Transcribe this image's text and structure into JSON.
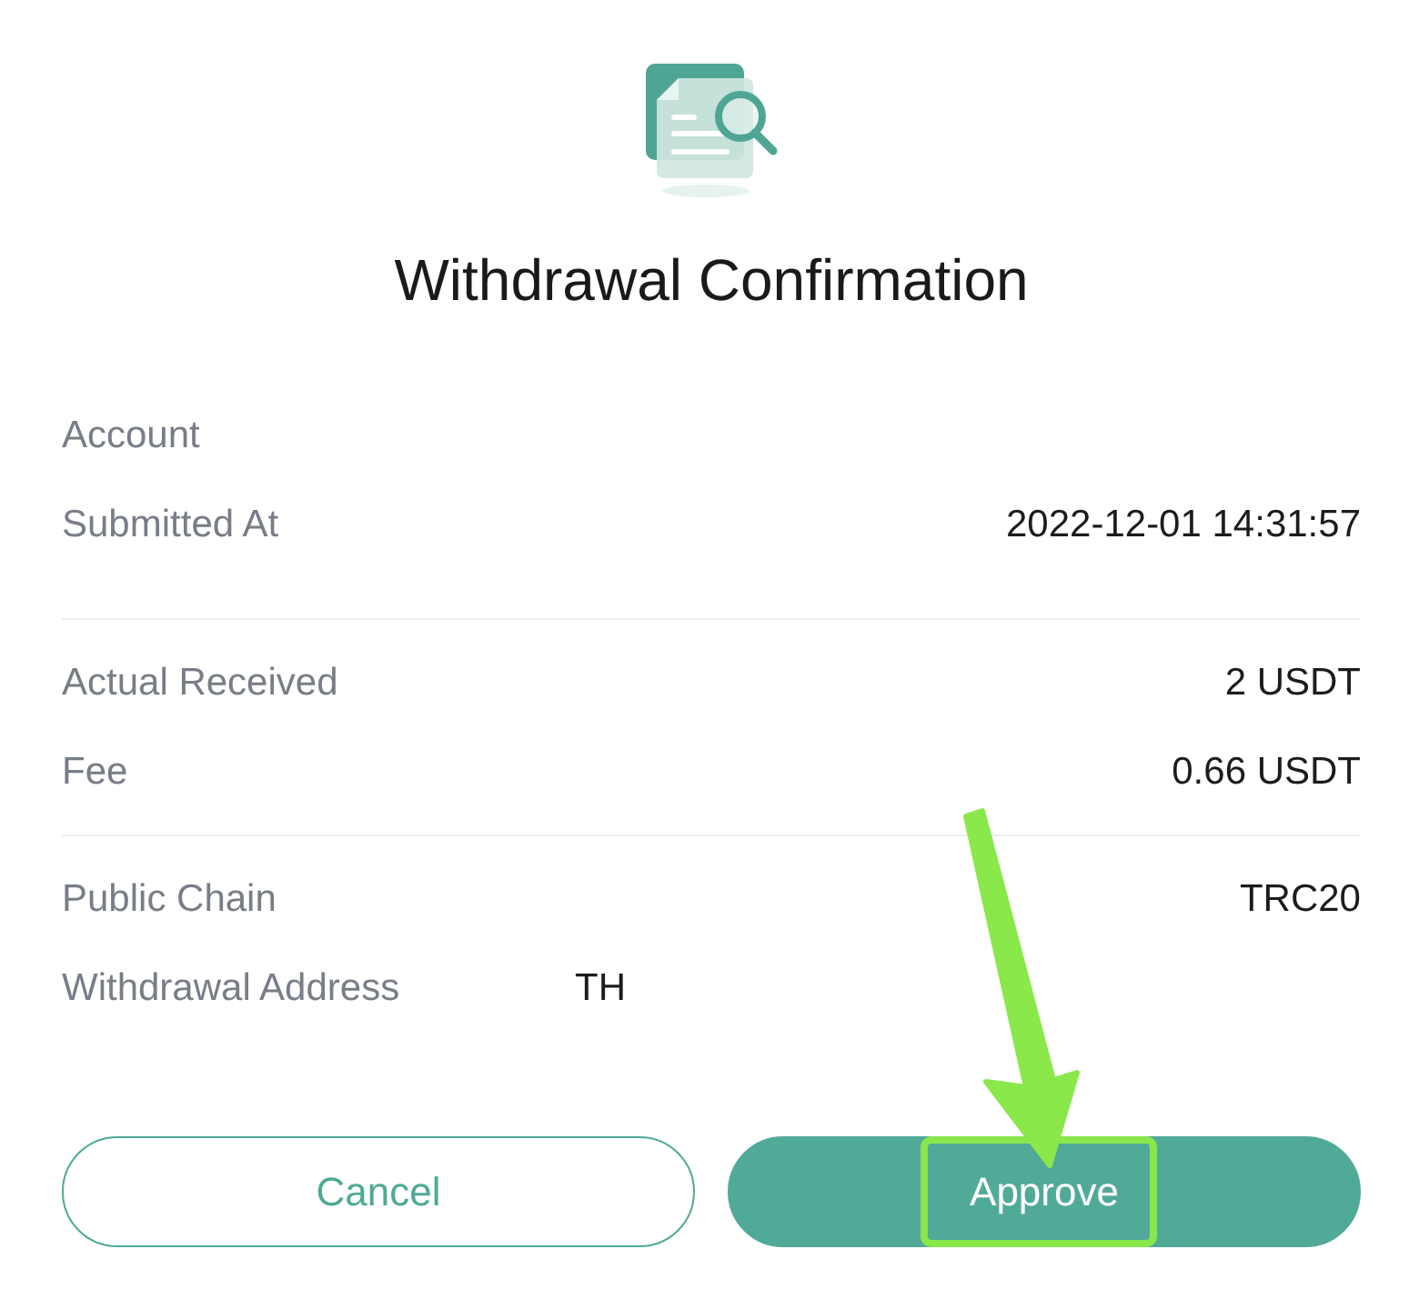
{
  "dialog": {
    "title": "Withdrawal Confirmation",
    "sections": [
      {
        "rows": [
          {
            "kind": "text",
            "label": "Account"
          },
          {
            "kind": "text",
            "label": "Submitted At",
            "value": "2022-12-01 14:31:57"
          }
        ]
      },
      {
        "rows": [
          {
            "kind": "text",
            "label": "Actual Received",
            "value": "2 USDT"
          },
          {
            "kind": "text",
            "label": "Fee",
            "value": "0.66 USDT"
          }
        ]
      },
      {
        "rows": [
          {
            "kind": "text",
            "label": "Public Chain",
            "value": "TRC20"
          },
          {
            "kind": "address",
            "label": "Withdrawal Address",
            "value": "TH"
          }
        ]
      }
    ],
    "buttons": [
      {
        "kind": "outline",
        "label": "Cancel",
        "highlighted": false
      },
      {
        "kind": "filled",
        "label": "Approve",
        "highlighted": true
      }
    ]
  }
}
